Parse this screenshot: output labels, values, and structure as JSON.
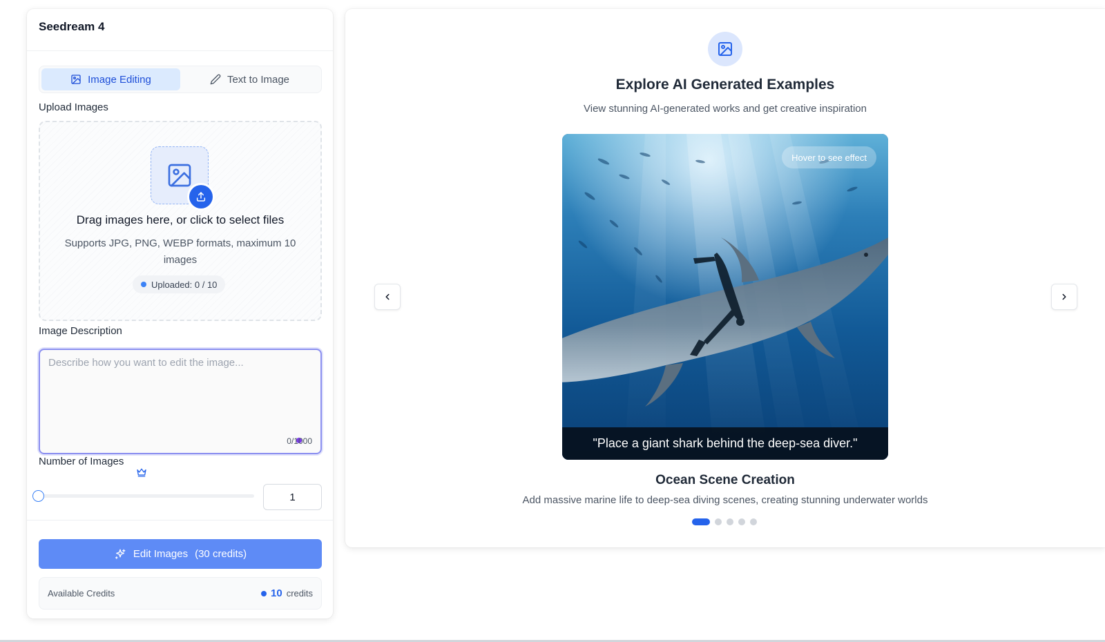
{
  "app": {
    "title": "Seedream 4"
  },
  "tabs": [
    {
      "label": "Image Editing",
      "icon": "image-icon",
      "active": true
    },
    {
      "label": "Text to Image",
      "icon": "pencil-icon",
      "active": false
    }
  ],
  "upload": {
    "label": "Upload Images",
    "title": "Drag images here, or click to select files",
    "subtitle": "Supports JPG, PNG, WEBP formats, maximum 10 images",
    "status": "Uploaded: 0 / 10"
  },
  "description": {
    "label": "Image Description",
    "placeholder": "Describe how you want to edit the image...",
    "value": "",
    "counter": "0/1000"
  },
  "image_count": {
    "label": "Number of Images",
    "value": "1",
    "min": 1,
    "max": 4,
    "premium_icon": "crown-icon"
  },
  "action": {
    "label": "Edit Images",
    "cost": "(30 credits)",
    "icon": "sparkles-icon"
  },
  "credits": {
    "label": "Available Credits",
    "value": "10",
    "unit": "credits"
  },
  "examples": {
    "icon": "image-icon",
    "title": "Explore AI Generated Examples",
    "subtitle": "View stunning AI-generated works and get creative inspiration",
    "hover_hint": "Hover to see effect",
    "caption": "\"Place a giant shark behind the deep-sea diver.\"",
    "slide_title": "Ocean Scene Creation",
    "slide_desc": "Add massive marine life to deep-sea diving scenes, creating stunning underwater worlds",
    "slide_count": 5,
    "active_slide": 1
  },
  "colors": {
    "accent": "#2563eb",
    "button": "#5e8bf6",
    "tab_active_bg": "#dbeafe",
    "focus_border": "#8b8ff0"
  }
}
